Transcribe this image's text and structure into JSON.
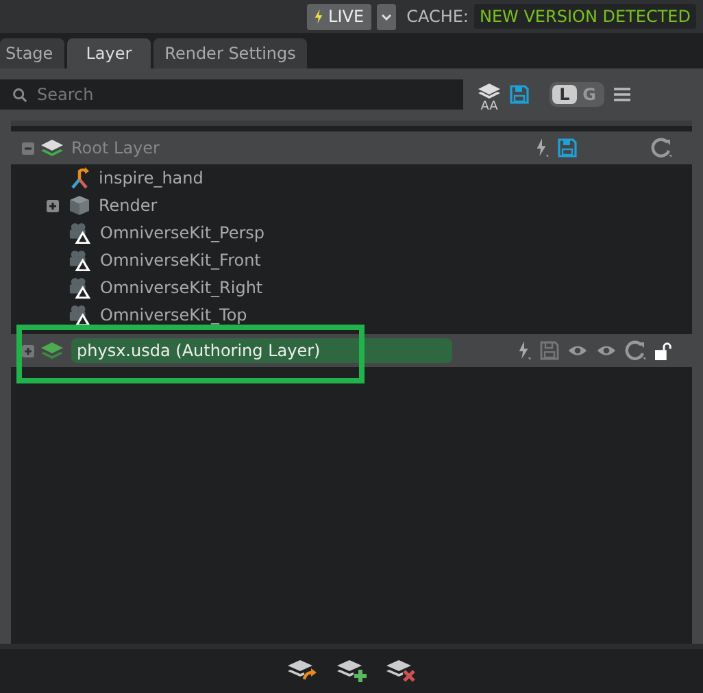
{
  "top_bar": {
    "live_label": "LIVE",
    "cache_label": "CACHE:",
    "cache_status": "NEW VERSION DETECTED"
  },
  "tabs": [
    {
      "label": "Stage",
      "selected": false
    },
    {
      "label": "Layer",
      "selected": true
    },
    {
      "label": "Render Settings",
      "selected": false
    }
  ],
  "search": {
    "placeholder": "Search"
  },
  "toolbar": {
    "aa_label": "AA",
    "toggle": [
      {
        "label": "L",
        "selected": true
      },
      {
        "label": "G",
        "selected": false
      }
    ]
  },
  "root_layer": {
    "name": "Root Layer",
    "expanded": true
  },
  "prims": [
    {
      "name": "inspire_hand",
      "kind": "xform",
      "expandable": false
    },
    {
      "name": "Render",
      "kind": "scope",
      "expandable": true
    },
    {
      "name": "OmniverseKit_Persp",
      "kind": "camera",
      "expandable": false
    },
    {
      "name": "OmniverseKit_Front",
      "kind": "camera",
      "expandable": false
    },
    {
      "name": "OmniverseKit_Right",
      "kind": "camera",
      "expandable": false
    },
    {
      "name": "OmniverseKit_Top",
      "kind": "camera",
      "expandable": false
    }
  ],
  "sublayer": {
    "name": "physx.usda (Authoring Layer)",
    "expanded": false,
    "highlighted": true
  }
}
